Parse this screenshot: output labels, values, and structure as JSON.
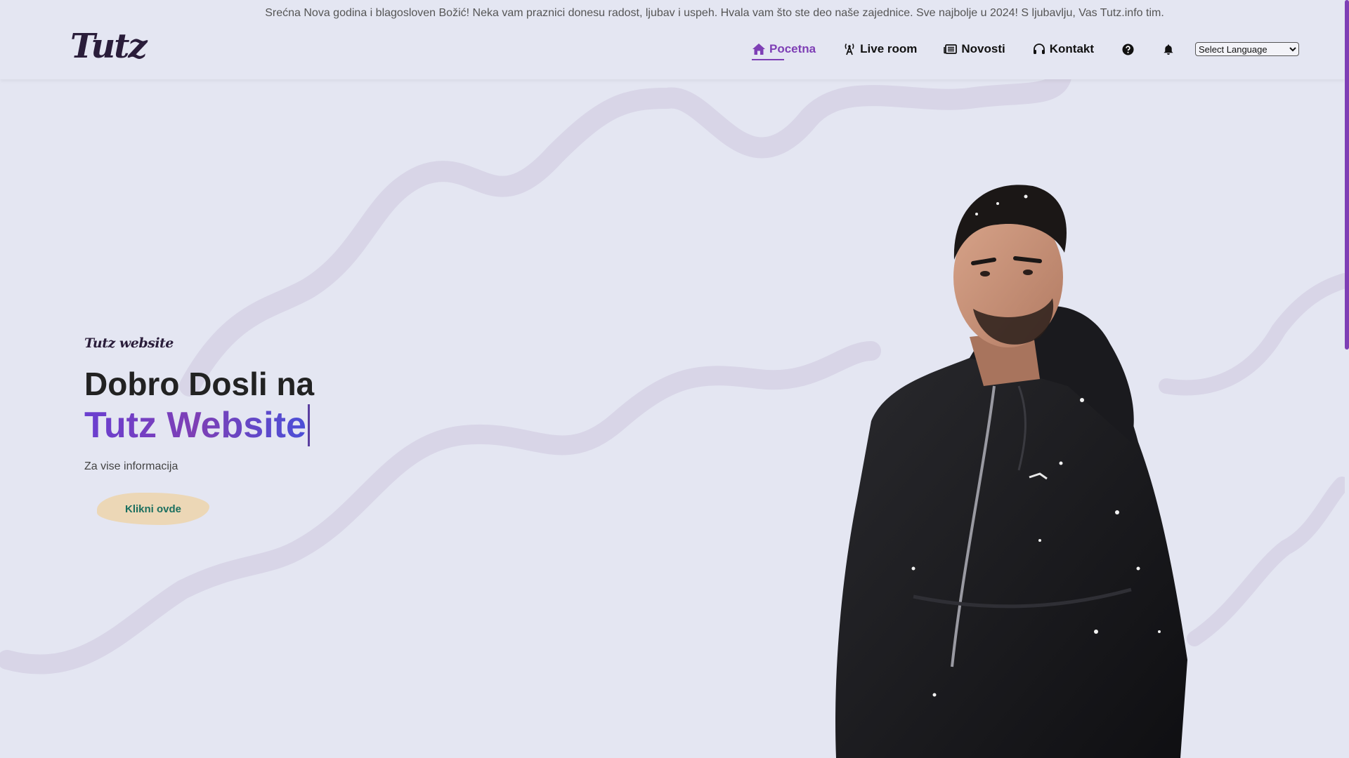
{
  "announcement": "Srećna Nova godina i blagosloven Božić! Neka vam praznici donesu radost, ljubav i uspeh. Hvala vam što ste deo naše zajednice. Sve najbolje u 2024! S ljubavlju, Vas Tutz.info tim.",
  "logo": {
    "text": "Tutz"
  },
  "nav": {
    "items": [
      {
        "label": "Pocetna",
        "icon": "home-icon",
        "active": true
      },
      {
        "label": "Live room",
        "icon": "broadcast-icon"
      },
      {
        "label": "Novosti",
        "icon": "newspaper-icon"
      },
      {
        "label": "Kontakt",
        "icon": "headset-icon"
      }
    ],
    "help_icon": "question-circle-icon",
    "notify_icon": "bell-icon",
    "language_select": "Select Language"
  },
  "hero": {
    "kicker": "Tutz website",
    "title": "Dobro Dosli na",
    "brand": "Tutz Website",
    "subtitle": "Za vise informacija",
    "cta_label": "Klikni ovde"
  },
  "colors": {
    "background": "#e4e6f2",
    "accent": "#7e3fb5",
    "cta_bg": "#ecd7b6",
    "cta_text": "#1b6f5f",
    "wave": "#d6d3e6"
  }
}
